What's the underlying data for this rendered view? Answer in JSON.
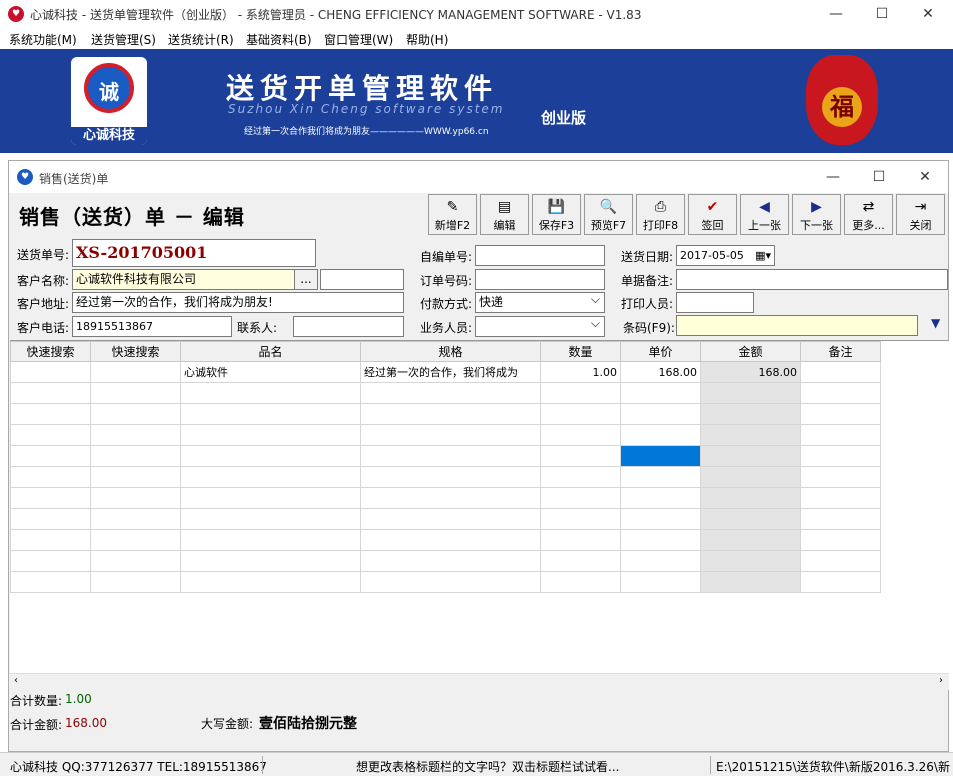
{
  "app": {
    "title": "心诚科技 - 送货单管理软件（创业版） - 系统管理员 - CHENG EFFICIENCY MANAGEMENT SOFTWARE - V1.83",
    "menus": [
      "系统功能(M)",
      "送货管理(S)",
      "送货统计(R)",
      "基础资料(B)",
      "窗口管理(W)",
      "帮助(H)"
    ]
  },
  "banner": {
    "logo_char": "诚",
    "logo_text": "心诚科技",
    "title": "送货开单管理软件",
    "subtitle": "Suzhou Xin Cheng software system",
    "slogan": "经过第一次合作我们将成为朋友——————WWW.yp66.cn",
    "edition": "创业版",
    "fu": "福"
  },
  "window": {
    "title": "销售(送货)单",
    "heading": "销售（送货）单 － 编辑"
  },
  "toolbar": [
    {
      "label": "新增F2",
      "icon": "✎"
    },
    {
      "label": "编辑",
      "icon": "▤"
    },
    {
      "label": "保存F3",
      "icon": "💾"
    },
    {
      "label": "预览F7",
      "icon": "🔍"
    },
    {
      "label": "打印F8",
      "icon": "⎙"
    },
    {
      "label": "签回",
      "icon": "✔"
    },
    {
      "label": "上一张",
      "icon": "◀"
    },
    {
      "label": "下一张",
      "icon": "▶"
    },
    {
      "label": "更多...",
      "icon": "⇄"
    },
    {
      "label": "关闭",
      "icon": "⇥"
    }
  ],
  "form": {
    "order_no_label": "送货单号:",
    "order_no": "XS-201705001",
    "self_no_label": "自编单号:",
    "self_no": "",
    "date_label": "送货日期:",
    "date": "2017-05-05",
    "customer_label": "客户名称:",
    "customer": "心诚软件科技有限公司",
    "customer_btn": "...",
    "order_code_label": "订单号码:",
    "order_code": "",
    "remark_label": "单据备注:",
    "remark": "",
    "address_label": "客户地址:",
    "address": "经过第一次的合作，我们将成为朋友!",
    "payment_label": "付款方式:",
    "payment": "快递",
    "printer_label": "打印人员:",
    "printer": "",
    "phone_label": "客户电话:",
    "phone": "18915513867",
    "contact_label": "联系人:",
    "contact": "",
    "salesman_label": "业务人员:",
    "salesman": "",
    "barcode_label": "条码(F9):",
    "barcode": ""
  },
  "grid": {
    "columns": [
      "快速搜索",
      "快速搜索",
      "品名",
      "规格",
      "数量",
      "单价",
      "金额",
      "备注"
    ],
    "rows": [
      [
        "",
        "",
        "心诚软件",
        "经过第一次的合作，我们将成为",
        "1.00",
        "168.00",
        "168.00",
        ""
      ]
    ]
  },
  "footer": {
    "total_qty_label": "合计数量:",
    "total_qty": "1.00",
    "total_amt_label": "合计金额:",
    "total_amt": "168.00",
    "upper_label": "大写金额:",
    "upper": "壹佰陆拾捌元整"
  },
  "status": {
    "left": "心诚科技 QQ:377126377 TEL:18915513867",
    "middle": "想更改表格标题栏的文字吗？双击标题栏试试看...",
    "right": "E:\\20151215\\送货软件\\新版2016.3.26\\新"
  },
  "colors": {
    "banner": "#1c3f9a",
    "order_no": "#8b0000",
    "selection": "#0078d7"
  }
}
